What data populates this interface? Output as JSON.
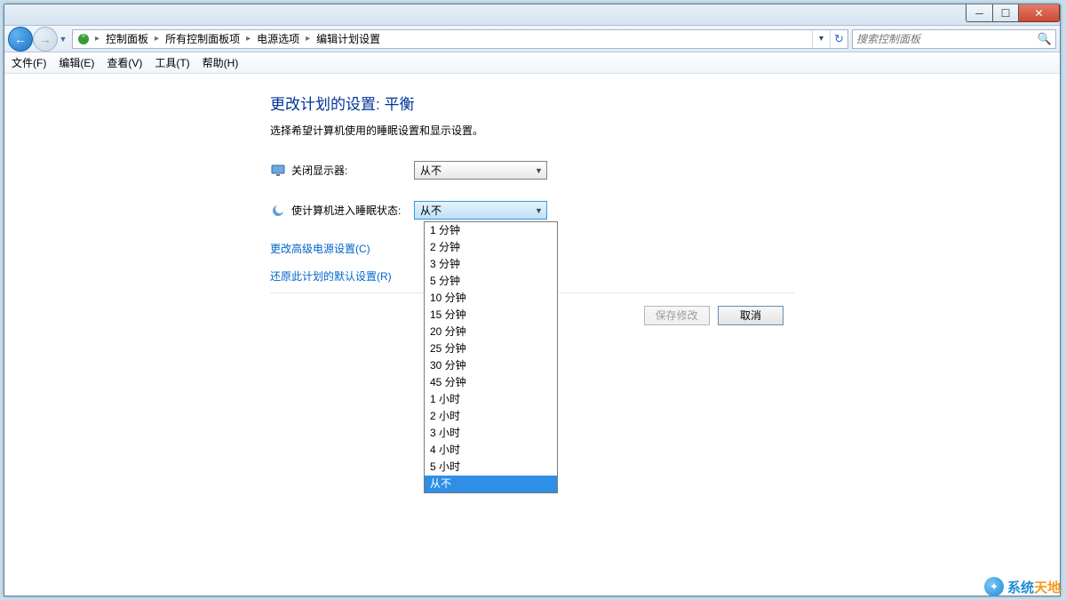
{
  "window_controls": {
    "min": "─",
    "max": "☐",
    "close": "✕"
  },
  "nav": {
    "back": "←",
    "fwd": "→",
    "drop": "▼",
    "addr_drop": "▾",
    "refresh": "↻"
  },
  "breadcrumb": {
    "sep": "▸",
    "items": [
      "控制面板",
      "所有控制面板项",
      "电源选项",
      "编辑计划设置"
    ]
  },
  "search": {
    "placeholder": "搜索控制面板"
  },
  "menus": [
    "文件(F)",
    "编辑(E)",
    "查看(V)",
    "工具(T)",
    "帮助(H)"
  ],
  "page": {
    "title": "更改计划的设置: 平衡",
    "desc": "选择希望计算机使用的睡眠设置和显示设置。"
  },
  "settings": {
    "display_off": {
      "label": "关闭显示器:",
      "value": "从不"
    },
    "sleep": {
      "label": "使计算机进入睡眠状态:",
      "value": "从不"
    }
  },
  "links": {
    "advanced": "更改高级电源设置(C)",
    "restore": "还原此计划的默认设置(R)"
  },
  "buttons": {
    "save": "保存修改",
    "cancel": "取消"
  },
  "dropdown_options": [
    "1 分钟",
    "2 分钟",
    "3 分钟",
    "5 分钟",
    "10 分钟",
    "15 分钟",
    "20 分钟",
    "25 分钟",
    "30 分钟",
    "45 分钟",
    "1 小时",
    "2 小时",
    "3 小时",
    "4 小时",
    "5 小时",
    "从不"
  ],
  "dropdown_selected_index": 15,
  "watermark": {
    "a": "系统",
    "b": "天地"
  },
  "combo_arrow": "▼"
}
